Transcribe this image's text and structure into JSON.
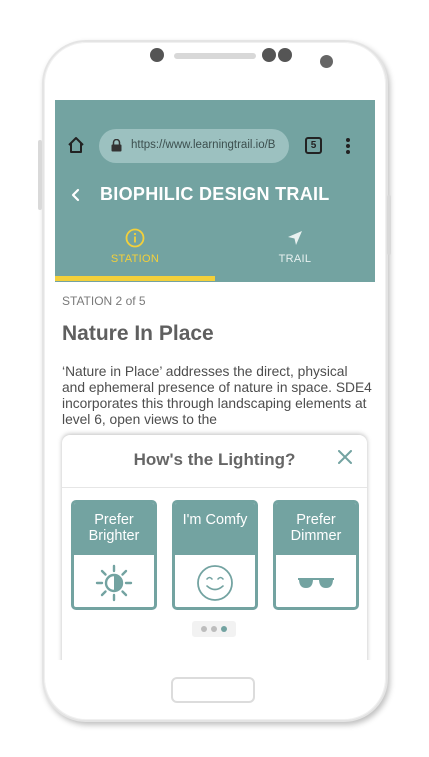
{
  "browser": {
    "url": "https://www.learningtrail.io/B",
    "tab_count": "5"
  },
  "app": {
    "title": "BIOPHILIC DESIGN TRAIL",
    "tabs": [
      {
        "label": "STATION",
        "icon": "info-icon",
        "active": true
      },
      {
        "label": "TRAIL",
        "icon": "navigation-icon",
        "active": false
      }
    ]
  },
  "station": {
    "count": "STATION 2 of 5",
    "title": "Nature In Place",
    "description": "‘Nature in Place’ addresses the direct, physical and ephemeral presence of nature in space. SDE4 incorporates this through landscaping elements at level 6, open views to the"
  },
  "survey": {
    "title": "How's the Lighting?",
    "options": [
      {
        "label": "Prefer Brighter",
        "icon": "brightness-icon"
      },
      {
        "label": "I'm Comfy",
        "icon": "smiley-icon"
      },
      {
        "label": "Prefer Dimmer",
        "icon": "sunglasses-icon"
      }
    ],
    "pager": {
      "count": 3,
      "active_index": 2
    }
  },
  "colors": {
    "teal": "#73a3a1",
    "accent_yellow": "#f3d03a"
  }
}
